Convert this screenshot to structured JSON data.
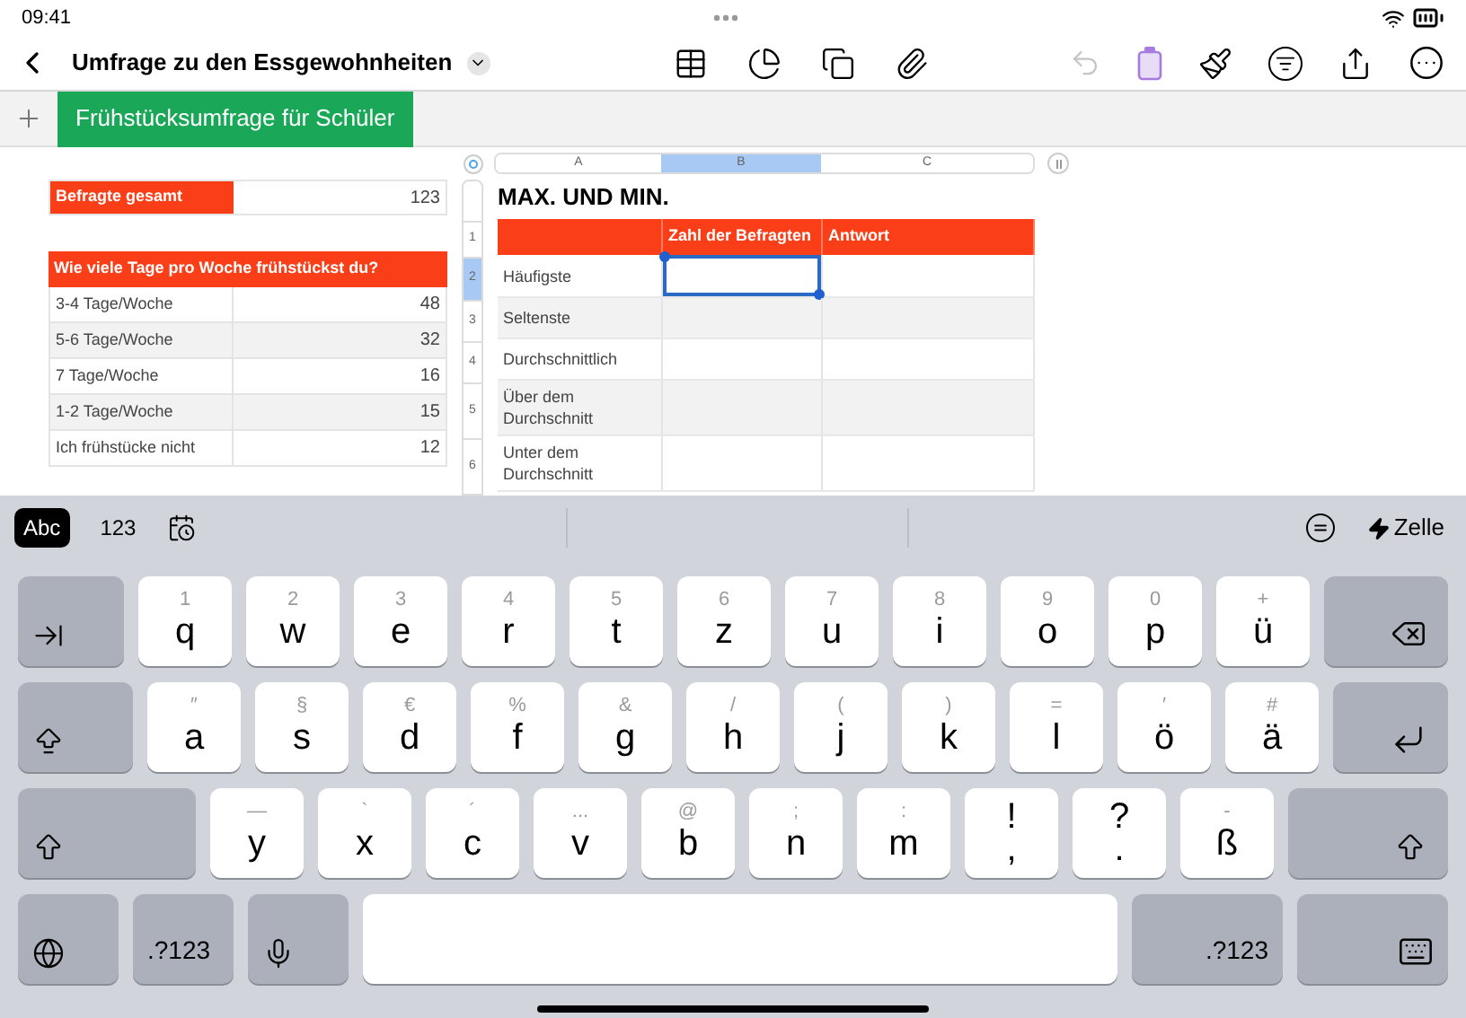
{
  "status_bar": {
    "time": "09:41"
  },
  "toolbar": {
    "title": "Umfrage zu den Essgewohnheiten",
    "undo": {
      "disabled": true
    }
  },
  "sheet_tabs": [
    {
      "label": "Frühstücksumfrage für Schüler",
      "selected": true
    }
  ],
  "summary_table": {
    "label": "Befragte gesamt",
    "value": "123"
  },
  "frequency_table": {
    "title": "Wie viele Tage pro Woche frühstückst du?",
    "rows": [
      {
        "label": "3-4 Tage/Woche",
        "value": "48"
      },
      {
        "label": "5-6 Tage/Woche",
        "value": "32"
      },
      {
        "label": "7 Tage/Woche",
        "value": "16"
      },
      {
        "label": "1-2 Tage/Woche",
        "value": "15"
      },
      {
        "label": "Ich frühstücke nicht",
        "value": "12"
      }
    ]
  },
  "minmax_table": {
    "title": "MAX. UND MIN.",
    "columns": [
      {
        "letter": "A",
        "selected": false
      },
      {
        "letter": "B",
        "selected": true
      },
      {
        "letter": "C",
        "selected": false
      }
    ],
    "headers": [
      "Zahl der Befragten",
      "Antwort"
    ],
    "row_numbers": [
      {
        "label": "1",
        "selected": false
      },
      {
        "label": "2",
        "selected": true
      },
      {
        "label": "3",
        "selected": false
      },
      {
        "label": "4",
        "selected": false
      },
      {
        "label": "5",
        "selected": false
      },
      {
        "label": "6",
        "selected": false
      }
    ],
    "rows": [
      {
        "label": "Häufigste",
        "selected": true
      },
      {
        "label": "Seltenste",
        "selected": false
      },
      {
        "label": "Durchschnittlich",
        "selected": false
      },
      {
        "label": "Über dem Durchschnitt",
        "selected": false
      },
      {
        "label": "Unter dem Durchschnitt",
        "selected": false
      }
    ]
  },
  "keyboard": {
    "modes": [
      {
        "label": "Abc",
        "selected": true
      },
      {
        "label": "123",
        "selected": false
      }
    ],
    "action": "Zelle",
    "rows": [
      [
        {
          "kind": "tab"
        },
        {
          "kind": "letter",
          "secondary": "1",
          "main": "q"
        },
        {
          "kind": "letter",
          "secondary": "2",
          "main": "w"
        },
        {
          "kind": "letter",
          "secondary": "3",
          "main": "e"
        },
        {
          "kind": "letter",
          "secondary": "4",
          "main": "r"
        },
        {
          "kind": "letter",
          "secondary": "5",
          "main": "t"
        },
        {
          "kind": "letter",
          "secondary": "6",
          "main": "z"
        },
        {
          "kind": "letter",
          "secondary": "7",
          "main": "u"
        },
        {
          "kind": "letter",
          "secondary": "8",
          "main": "i"
        },
        {
          "kind": "letter",
          "secondary": "9",
          "main": "o"
        },
        {
          "kind": "letter",
          "secondary": "0",
          "main": "p"
        },
        {
          "kind": "letter",
          "secondary": "+",
          "main": "ü"
        },
        {
          "kind": "delete"
        }
      ],
      [
        {
          "kind": "capslock"
        },
        {
          "kind": "letter",
          "secondary": "″",
          "main": "a"
        },
        {
          "kind": "letter",
          "secondary": "§",
          "main": "s"
        },
        {
          "kind": "letter",
          "secondary": "€",
          "main": "d"
        },
        {
          "kind": "letter",
          "secondary": "%",
          "main": "f"
        },
        {
          "kind": "letter",
          "secondary": "&",
          "main": "g"
        },
        {
          "kind": "letter",
          "secondary": "/",
          "main": "h"
        },
        {
          "kind": "letter",
          "secondary": "(",
          "main": "j"
        },
        {
          "kind": "letter",
          "secondary": ")",
          "main": "k"
        },
        {
          "kind": "letter",
          "secondary": "=",
          "main": "l"
        },
        {
          "kind": "letter",
          "secondary": "′",
          "main": "ö"
        },
        {
          "kind": "letter",
          "secondary": "#",
          "main": "ä"
        },
        {
          "kind": "return"
        }
      ],
      [
        {
          "kind": "shift"
        },
        {
          "kind": "letter",
          "secondary": "—",
          "main": "y"
        },
        {
          "kind": "letter",
          "secondary": "`",
          "main": "x"
        },
        {
          "kind": "letter",
          "secondary": "´",
          "main": "c"
        },
        {
          "kind": "letter",
          "secondary": "...",
          "main": "v"
        },
        {
          "kind": "letter",
          "secondary": "@",
          "main": "b"
        },
        {
          "kind": "letter",
          "secondary": ";",
          "main": "n"
        },
        {
          "kind": "letter",
          "secondary": ":",
          "main": "m"
        },
        {
          "kind": "dual",
          "secondary": "!",
          "main": ","
        },
        {
          "kind": "dual",
          "secondary": "?",
          "main": "."
        },
        {
          "kind": "letter",
          "secondary": "-",
          "main": "ß"
        },
        {
          "kind": "shift"
        }
      ],
      [
        {
          "kind": "globe"
        },
        {
          "kind": "label",
          "label": ".?123"
        },
        {
          "kind": "mic"
        },
        {
          "kind": "space"
        },
        {
          "kind": "label",
          "label": ".?123"
        },
        {
          "kind": "keyboard"
        }
      ]
    ]
  }
}
